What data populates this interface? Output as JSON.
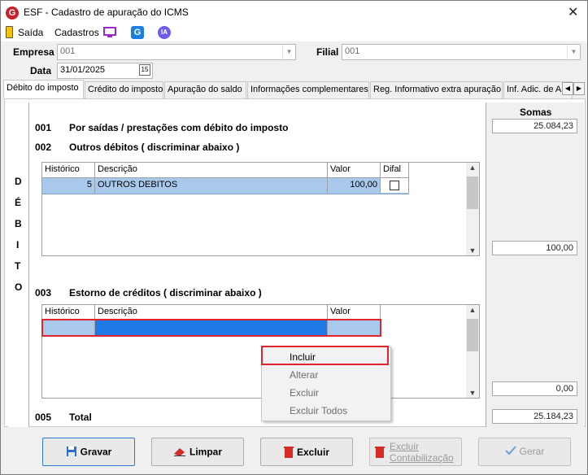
{
  "window": {
    "title": "ESF - Cadastro de apuração do ICMS",
    "logo_letter": "G"
  },
  "menu": {
    "saida": "Saída",
    "cadastros": "Cadastros",
    "ia": "IA"
  },
  "form": {
    "empresa_label": "Empresa",
    "empresa_value": "001",
    "filial_label": "Filial",
    "filial_value": "001",
    "data_label": "Data",
    "data_value": "31/01/2025",
    "cal_icon": "15"
  },
  "tabs": [
    "Débito do imposto",
    "Crédito do imposto",
    "Apuração do saldo",
    "Informações complementares",
    "Reg. Informativo extra apuração",
    "Inf. Adic. de A"
  ],
  "debito": {
    "side_letters": [
      "D",
      "É",
      "B",
      "I",
      "T",
      "O"
    ],
    "l001_code": "001",
    "l001_text": "Por saídas / prestações com débito do imposto",
    "l002_code": "002",
    "l002_text": "Outros débitos ( discriminar abaixo )",
    "l003_code": "003",
    "l003_text": "Estorno de créditos ( discriminar abaixo )",
    "l005_code": "005",
    "l005_text": "Total"
  },
  "grid1": {
    "headers": {
      "historico": "Histórico",
      "descricao": "Descrição",
      "valor": "Valor",
      "difal": "Difal"
    },
    "row": {
      "historico": "5",
      "descricao": "OUTROS DEBITOS",
      "valor": "100,00"
    }
  },
  "grid2": {
    "headers": {
      "historico": "Histórico",
      "descricao": "Descrição",
      "valor": "Valor"
    }
  },
  "somas": {
    "title": "Somas",
    "s001": "25.084,23",
    "s002": "100,00",
    "s003": "0,00",
    "s005": "25.184,23"
  },
  "context_menu": [
    "Incluir",
    "Alterar",
    "Excluir",
    "Excluir Todos"
  ],
  "buttons": {
    "gravar": "Gravar",
    "limpar": "Limpar",
    "excluir": "Excluir",
    "excluir_cont_1": "Excluir",
    "excluir_cont_2": "Contabilização",
    "gerar": "Gerar"
  },
  "colors": {
    "selection": "#1e78e6",
    "highlight": "#e0242c",
    "accent": "#2e78d3"
  }
}
